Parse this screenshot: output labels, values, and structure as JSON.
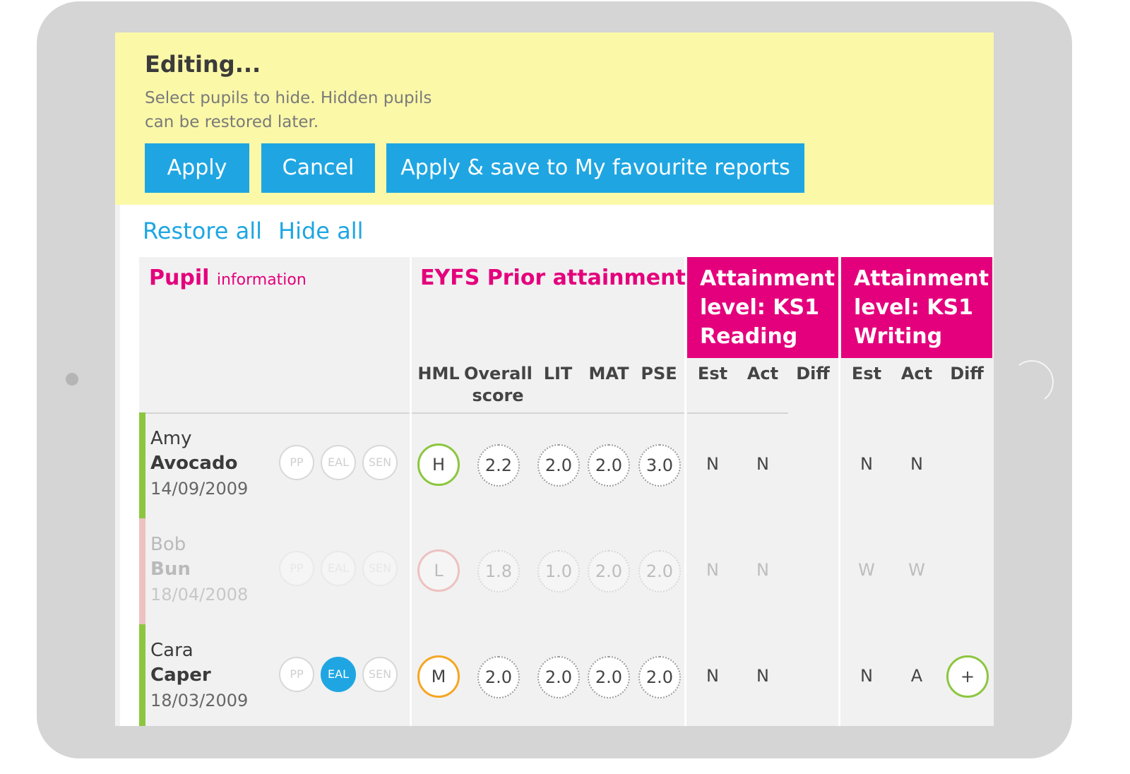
{
  "edit_panel": {
    "title": "Editing...",
    "description": "Select pupils to hide. Hidden pupils can be restored later.",
    "apply_label": "Apply",
    "cancel_label": "Cancel",
    "apply_save_label": "Apply & save to My favourite reports"
  },
  "links": {
    "restore_all": "Restore all",
    "hide_all": "Hide all"
  },
  "columns": {
    "pupil_title": "Pupil",
    "pupil_subtitle": "information",
    "eyfs_title": "EYFS Prior attainment",
    "ks1_reading": "Attainment level: KS1 Reading",
    "ks1_writing": "Attainment level: KS1 Writing",
    "eyfs_sub": [
      "HML",
      "Overall score",
      "LIT",
      "MAT",
      "PSE"
    ],
    "ks1_sub": [
      "Est",
      "Act",
      "Diff"
    ]
  },
  "badges": [
    "PP",
    "EAL",
    "SEN"
  ],
  "colors": {
    "accent_blue": "#1fa6e2",
    "magenta": "#e4007c",
    "edit_yellow": "#fbf8a8",
    "green": "#8cc63f",
    "red": "#e85050",
    "orange": "#f5a623"
  },
  "pupils": [
    {
      "first": "Amy",
      "last": "Avocado",
      "dob": "14/09/2009",
      "status_color": "#8cc63f",
      "hidden": false,
      "badges_on": [
        false,
        false,
        false
      ],
      "hml": "H",
      "hml_color": "#8cc63f",
      "overall": "2.2",
      "lit": "2.0",
      "mat": "2.0",
      "pse": "3.0",
      "read_est": "N",
      "read_act": "N",
      "read_diff": "",
      "write_est": "N",
      "write_act": "N",
      "write_diff": ""
    },
    {
      "first": "Bob",
      "last": "Bun",
      "dob": "18/04/2008",
      "status_color": "#e85050",
      "hidden": true,
      "badges_on": [
        false,
        false,
        false
      ],
      "hml": "L",
      "hml_color": "#e85050",
      "overall": "1.8",
      "lit": "1.0",
      "mat": "2.0",
      "pse": "2.0",
      "read_est": "N",
      "read_act": "N",
      "read_diff": "",
      "write_est": "W",
      "write_act": "W",
      "write_diff": ""
    },
    {
      "first": "Cara",
      "last": "Caper",
      "dob": "18/03/2009",
      "status_color": "#8cc63f",
      "hidden": false,
      "badges_on": [
        false,
        true,
        false
      ],
      "hml": "M",
      "hml_color": "#f5a623",
      "overall": "2.0",
      "lit": "2.0",
      "mat": "2.0",
      "pse": "2.0",
      "read_est": "N",
      "read_act": "N",
      "read_diff": "",
      "write_est": "N",
      "write_act": "A",
      "write_diff": "+"
    }
  ]
}
